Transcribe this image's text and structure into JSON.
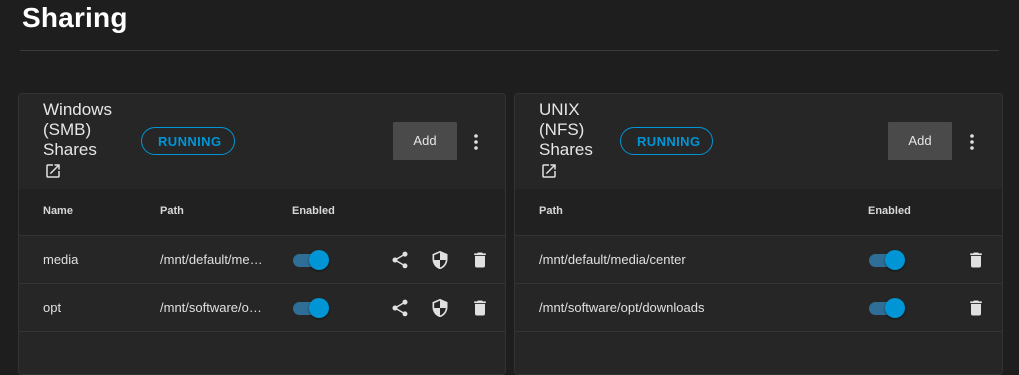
{
  "page": {
    "title": "Sharing"
  },
  "smb": {
    "title": "Windows (SMB) Shares",
    "status": "RUNNING",
    "add_label": "Add",
    "columns": [
      "Name",
      "Path",
      "Enabled"
    ],
    "rows": [
      {
        "name": "media",
        "path": "/mnt/default/me…",
        "enabled": true
      },
      {
        "name": "opt",
        "path": "/mnt/software/o…",
        "enabled": true
      }
    ]
  },
  "nfs": {
    "title": "UNIX (NFS) Shares",
    "status": "RUNNING",
    "add_label": "Add",
    "columns": [
      "Path",
      "Enabled"
    ],
    "rows": [
      {
        "path": "/mnt/default/media/center",
        "enabled": true
      },
      {
        "path": "/mnt/software/opt/downloads",
        "enabled": true
      }
    ]
  },
  "icons": {
    "open": "open-in-new-icon",
    "more": "more-vert-icon",
    "share": "share-icon",
    "security": "security-shield-icon",
    "delete": "delete-icon"
  },
  "colors": {
    "accent": "#0095d5",
    "background": "#1e1e1e",
    "card": "#262626",
    "button": "#4a4a4a"
  }
}
